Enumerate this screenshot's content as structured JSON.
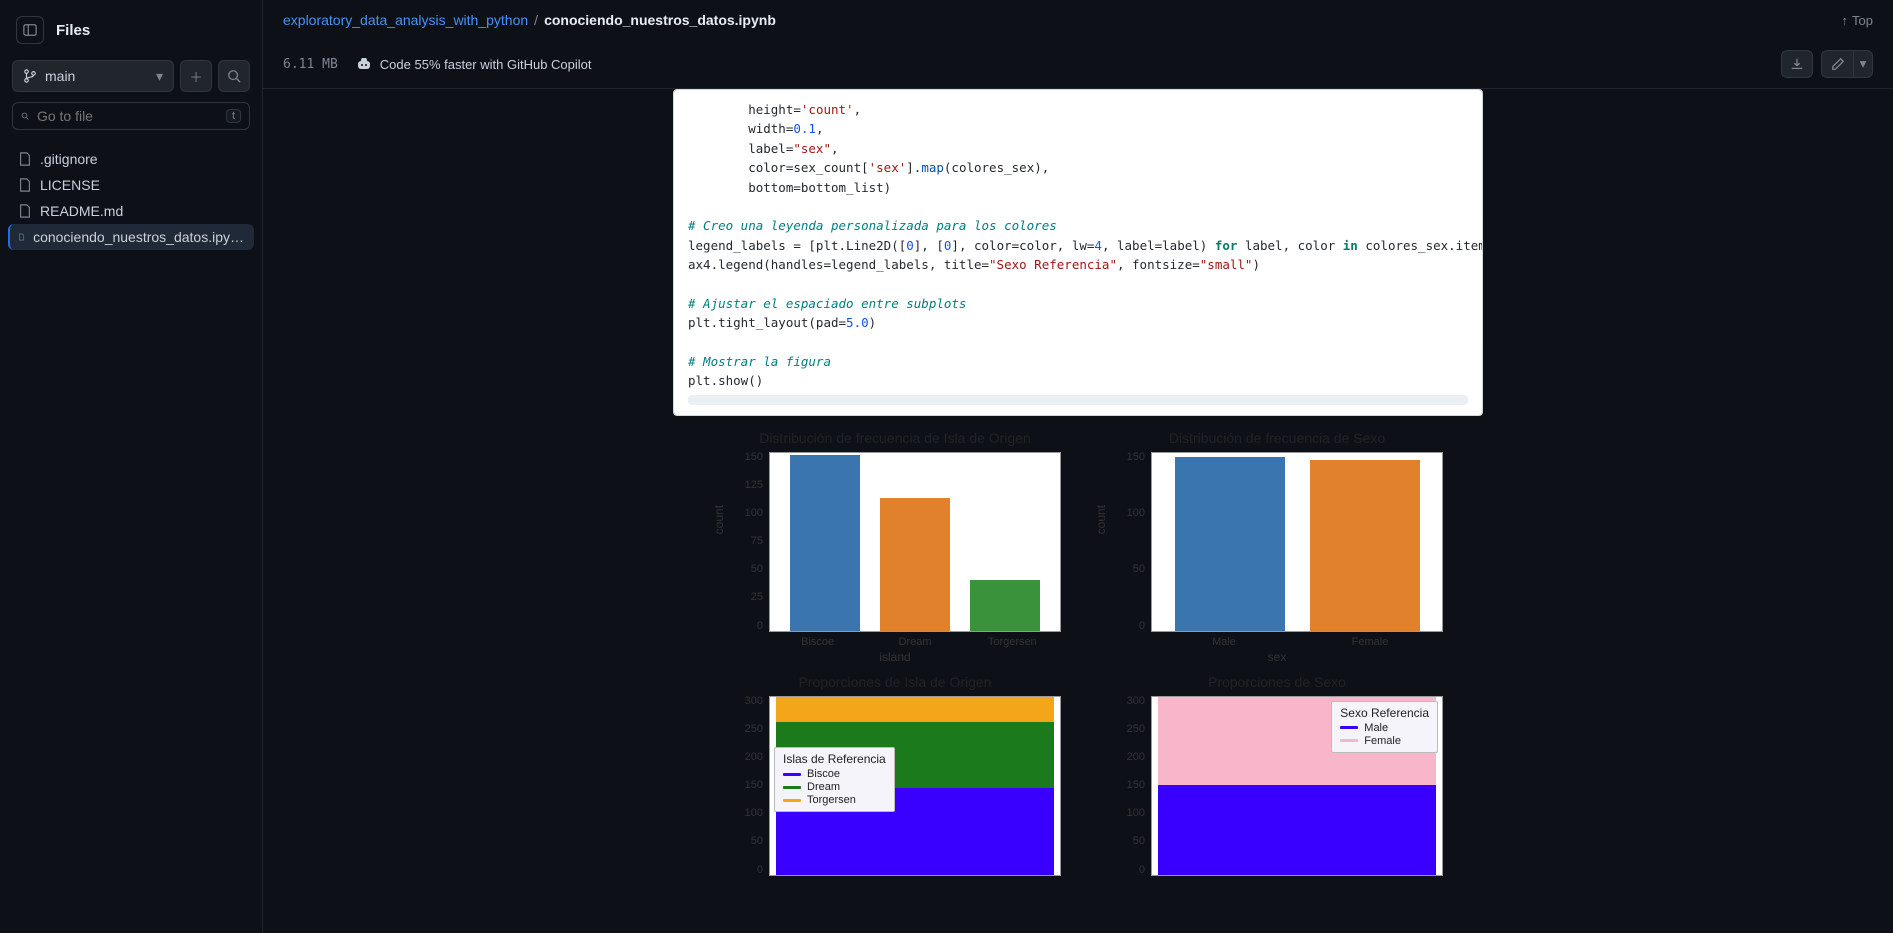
{
  "sidebar": {
    "title": "Files",
    "branch": "main",
    "goto_placeholder": "Go to file",
    "goto_kbd": "t",
    "files": [
      {
        "name": ".gitignore"
      },
      {
        "name": "LICENSE"
      },
      {
        "name": "README.md"
      },
      {
        "name": "conociendo_nuestros_datos.ipy…"
      }
    ]
  },
  "breadcrumb": {
    "parent": "exploratory_data_analysis_with_python",
    "sep": "/",
    "current": "conociendo_nuestros_datos.ipynb",
    "top_label": "Top"
  },
  "toolbar": {
    "filesize": "6.11 MB",
    "copilot": "Code 55% faster with GitHub Copilot"
  },
  "code": {
    "l1a": "        height=",
    "l1b": "'count'",
    "l1c": ",",
    "l2a": "        width=",
    "l2b": "0.1",
    "l2c": ",",
    "l3a": "        label=",
    "l3b": "\"sex\"",
    "l3c": ",",
    "l4a": "        color=sex_count[",
    "l4b": "'sex'",
    "l4c": "].",
    "l4d": "map",
    "l4e": "(colores_sex),",
    "l5a": "        bottom=bottom_list)",
    "c1": "# Creo una leyenda personalizada para los colores",
    "l6a": "legend_labels = [plt.Line2D([",
    "l6b": "0",
    "l6c": "], [",
    "l6d": "0",
    "l6e": "], color=color, lw=",
    "l6f": "4",
    "l6g": ", label=label) ",
    "l6h": "for",
    "l6i": " label, color ",
    "l6j": "in",
    "l6k": " colores_sex.items()]",
    "l7a": "ax4.legend(handles=legend_labels, title=",
    "l7b": "\"Sexo Referencia\"",
    "l7c": ", fontsize=",
    "l7d": "\"small\"",
    "l7e": ")",
    "c2": "# Ajustar el espaciado entre subplots",
    "l8a": "plt.tight_layout(pad=",
    "l8b": "5.0",
    "l8c": ")",
    "c3": "# Mostrar la figura",
    "l9": "plt.show()"
  },
  "chart_data": [
    {
      "id": "island_freq",
      "type": "bar",
      "title": "Distribución de frecuencia de Isla de Origen",
      "xlabel": "island",
      "ylabel": "count",
      "yticks": [
        "150",
        "125",
        "100",
        "75",
        "50",
        "25",
        "0"
      ],
      "categories": [
        "Biscoe",
        "Dream",
        "Torgersen"
      ],
      "values": [
        163,
        123,
        47
      ],
      "colors": [
        "#3b75af",
        "#e1812c",
        "#3a923a"
      ],
      "ylim": [
        0,
        165
      ]
    },
    {
      "id": "sex_freq",
      "type": "bar",
      "title": "Distribución de frecuencia de Sexo",
      "xlabel": "sex",
      "ylabel": "count",
      "yticks": [
        "150",
        "100",
        "50",
        "0"
      ],
      "categories": [
        "Male",
        "Female"
      ],
      "values": [
        168,
        165
      ],
      "colors": [
        "#3b75af",
        "#e1812c"
      ],
      "ylim": [
        0,
        172
      ]
    },
    {
      "id": "island_prop",
      "type": "stacked",
      "title": "Proporciones de Isla de Origen",
      "yticks": [
        "300",
        "250",
        "200",
        "150",
        "100",
        "50",
        "0"
      ],
      "ylim": [
        0,
        333
      ],
      "series": [
        {
          "name": "Biscoe",
          "value": 163,
          "color": "#3a00ff"
        },
        {
          "name": "Dream",
          "value": 123,
          "color": "#1b7a1b"
        },
        {
          "name": "Torgersen",
          "value": 47,
          "color": "#f4a61a"
        }
      ],
      "legend_title": "Islas de Referencia",
      "legend_pos": "inside-left"
    },
    {
      "id": "sex_prop",
      "type": "stacked",
      "title": "Proporciones de Sexo",
      "yticks": [
        "300",
        "250",
        "200",
        "150",
        "100",
        "50",
        "0"
      ],
      "ylim": [
        0,
        333
      ],
      "series": [
        {
          "name": "Male",
          "value": 168,
          "color": "#3a00ff"
        },
        {
          "name": "Female",
          "value": 165,
          "color": "#f7b6c9"
        }
      ],
      "legend_title": "Sexo Referencia",
      "legend_pos": "top-right"
    }
  ]
}
